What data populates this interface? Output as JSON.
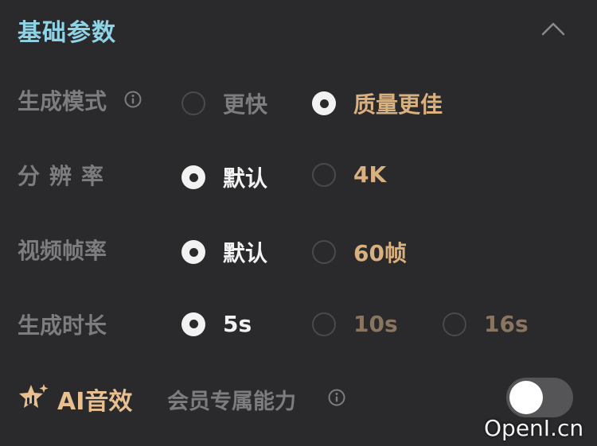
{
  "section": {
    "title": "基础参数",
    "collapse_icon": "chevron-up-icon"
  },
  "rows": {
    "mode": {
      "label": "生成模式",
      "info_icon": "info-icon",
      "options": [
        {
          "label": "更快",
          "selected": false
        },
        {
          "label": "质量更佳",
          "selected": true
        }
      ]
    },
    "resolution": {
      "label": "分辨率",
      "options": [
        {
          "label": "默认",
          "selected": true
        },
        {
          "label": "4K",
          "selected": false
        }
      ]
    },
    "framerate": {
      "label": "视频帧率",
      "options": [
        {
          "label": "默认",
          "selected": true
        },
        {
          "label": "60帧",
          "selected": false
        }
      ]
    },
    "duration": {
      "label": "生成时长",
      "options": [
        {
          "label": "5s",
          "selected": true
        },
        {
          "label": "10s",
          "selected": false
        },
        {
          "label": "16s",
          "selected": false
        }
      ]
    }
  },
  "ai_audio": {
    "icon": "sparkle-star-icon",
    "label": "AI音效",
    "member_label": "会员专属能力",
    "info_icon": "info-icon",
    "toggle_on": false
  },
  "watermark": "OpenI.cn",
  "colors": {
    "background": "#2a2a2c",
    "title": "#8fd3e6",
    "accent_gold": "#d9b07f",
    "label_gray": "#7d7d80",
    "selected_text": "#f2f2f2"
  }
}
